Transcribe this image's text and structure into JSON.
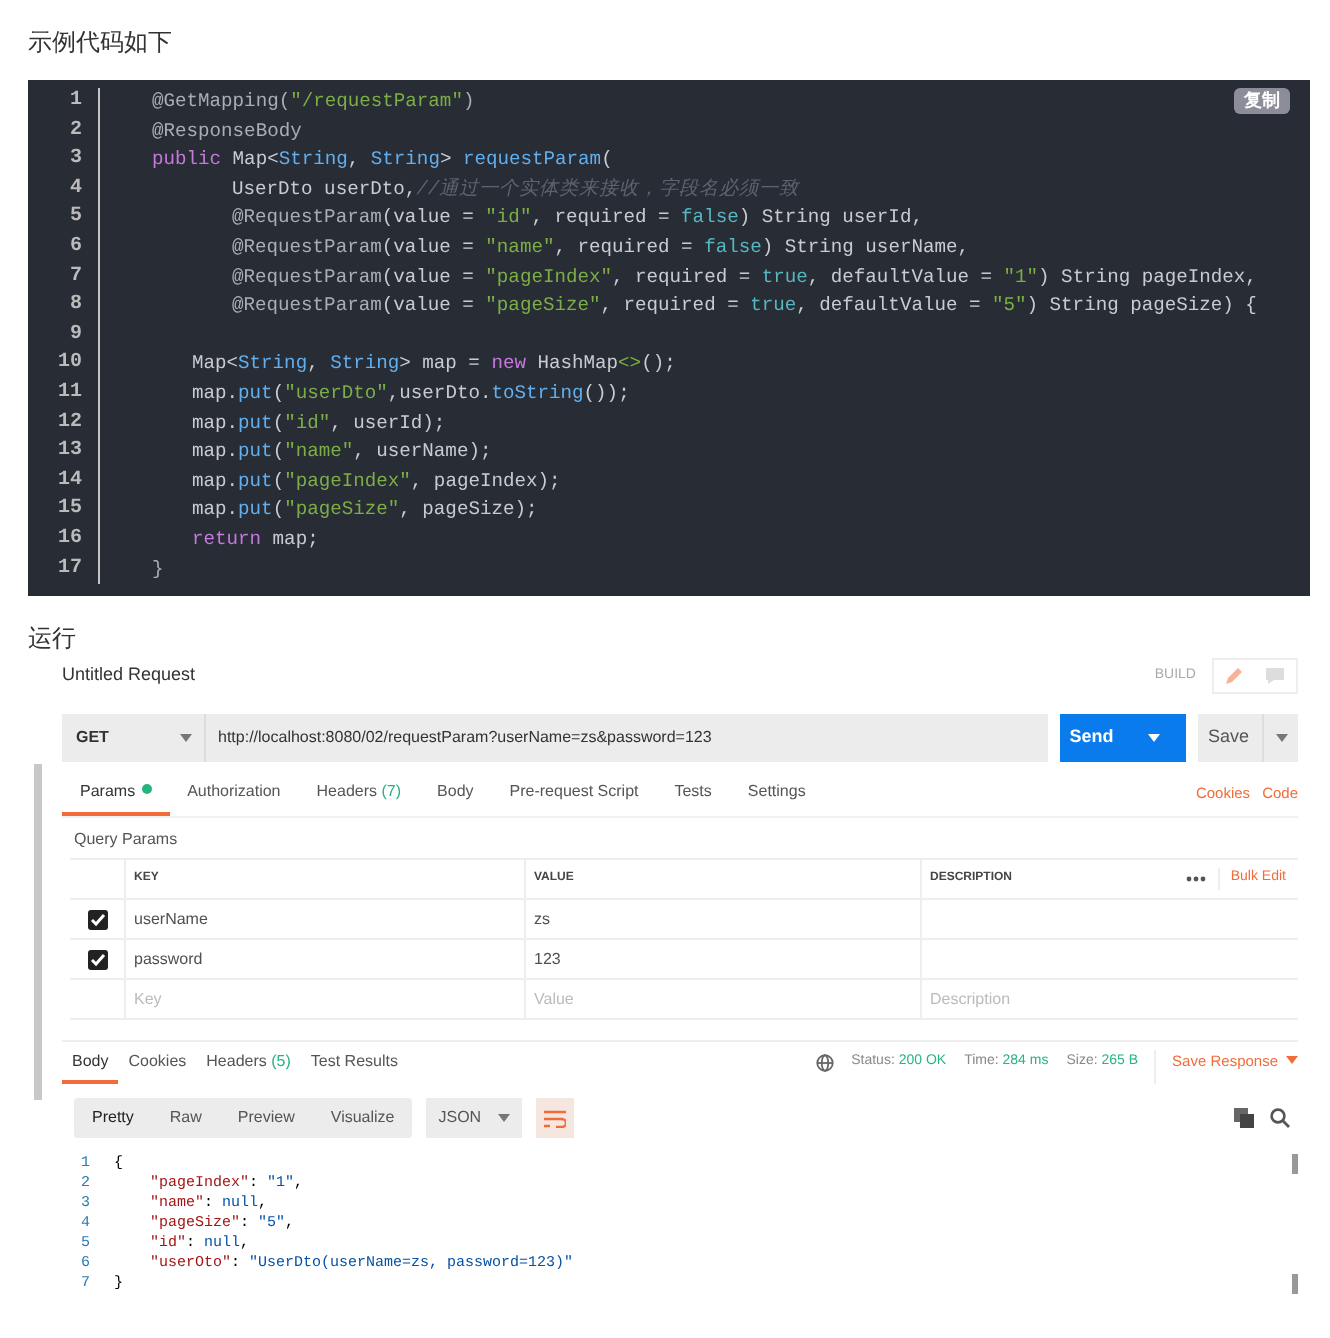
{
  "intro": "示例代码如下",
  "code_block": {
    "copy_label": "复制",
    "lines": [
      {
        "number": "1",
        "kind": "outer",
        "tokens": [
          {
            "kind": "ann",
            "text": "@GetMapping("
          },
          {
            "kind": "str",
            "text": "\"/requestParam\""
          },
          {
            "kind": "ann",
            "text": ")"
          }
        ]
      },
      {
        "number": "2",
        "kind": "outer",
        "tokens": [
          {
            "kind": "ann",
            "text": "@ResponseBody"
          }
        ]
      },
      {
        "number": "3",
        "kind": "outer",
        "tokens": [
          {
            "kind": "kw",
            "text": "public"
          },
          {
            "kind": "pl",
            "text": " Map<"
          },
          {
            "kind": "ty",
            "text": "String"
          },
          {
            "kind": "pl",
            "text": ", "
          },
          {
            "kind": "ty",
            "text": "String"
          },
          {
            "kind": "pl",
            "text": "> "
          },
          {
            "kind": "fn",
            "text": "requestParam"
          },
          {
            "kind": "pl",
            "text": "("
          }
        ]
      },
      {
        "number": "4",
        "kind": "param",
        "tokens": [
          {
            "kind": "pl",
            "text": "UserDto userDto,"
          },
          {
            "kind": "cm",
            "text": "//通过一个实体类来接收，字段名必须一致"
          }
        ]
      },
      {
        "number": "5",
        "kind": "param",
        "tokens": [
          {
            "kind": "ann",
            "text": "@RequestParam"
          },
          {
            "kind": "pl",
            "text": "(value = "
          },
          {
            "kind": "str",
            "text": "\"id\""
          },
          {
            "kind": "pl",
            "text": ", required = "
          },
          {
            "kind": "lit",
            "text": "false"
          },
          {
            "kind": "pl",
            "text": ") String userId,"
          }
        ]
      },
      {
        "number": "6",
        "kind": "param",
        "tokens": [
          {
            "kind": "ann",
            "text": "@RequestParam"
          },
          {
            "kind": "pl",
            "text": "(value = "
          },
          {
            "kind": "str",
            "text": "\"name\""
          },
          {
            "kind": "pl",
            "text": ", required = "
          },
          {
            "kind": "lit",
            "text": "false"
          },
          {
            "kind": "pl",
            "text": ") String userName,"
          }
        ]
      },
      {
        "number": "7",
        "kind": "param",
        "tokens": [
          {
            "kind": "ann",
            "text": "@RequestParam"
          },
          {
            "kind": "pl",
            "text": "(value = "
          },
          {
            "kind": "str",
            "text": "\"pageIndex\""
          },
          {
            "kind": "pl",
            "text": ", required = "
          },
          {
            "kind": "lit",
            "text": "true"
          },
          {
            "kind": "pl",
            "text": ", defaultValue = "
          },
          {
            "kind": "str",
            "text": "\"1\""
          },
          {
            "kind": "pl",
            "text": ") String pageIndex,"
          }
        ]
      },
      {
        "number": "8",
        "kind": "param",
        "tokens": [
          {
            "kind": "ann",
            "text": "@RequestParam"
          },
          {
            "kind": "pl",
            "text": "(value = "
          },
          {
            "kind": "str",
            "text": "\"pageSize\""
          },
          {
            "kind": "pl",
            "text": ", required = "
          },
          {
            "kind": "lit",
            "text": "true"
          },
          {
            "kind": "pl",
            "text": ", defaultValue = "
          },
          {
            "kind": "str",
            "text": "\"5\""
          },
          {
            "kind": "pl",
            "text": ") String pageSize) {"
          }
        ]
      },
      {
        "number": "9",
        "kind": "body"
      },
      {
        "number": "10",
        "kind": "body",
        "tokens": [
          {
            "kind": "pl",
            "text": "Map<"
          },
          {
            "kind": "ty",
            "text": "String"
          },
          {
            "kind": "pl",
            "text": ", "
          },
          {
            "kind": "ty",
            "text": "String"
          },
          {
            "kind": "pl",
            "text": "> map = "
          },
          {
            "kind": "kw",
            "text": "new"
          },
          {
            "kind": "pl",
            "text": " HashMap"
          },
          {
            "kind": "str",
            "text": "<>"
          },
          {
            "kind": "pl",
            "text": "();"
          }
        ]
      },
      {
        "number": "11",
        "kind": "body",
        "tokens": [
          {
            "kind": "pl",
            "text": "map."
          },
          {
            "kind": "fn",
            "text": "put"
          },
          {
            "kind": "pl",
            "text": "("
          },
          {
            "kind": "str",
            "text": "\"userDto\""
          },
          {
            "kind": "pl",
            "text": ",userDto."
          },
          {
            "kind": "fn",
            "text": "toString"
          },
          {
            "kind": "pl",
            "text": "());"
          }
        ]
      },
      {
        "number": "12",
        "kind": "body",
        "tokens": [
          {
            "kind": "pl",
            "text": "map."
          },
          {
            "kind": "fn",
            "text": "put"
          },
          {
            "kind": "pl",
            "text": "("
          },
          {
            "kind": "str",
            "text": "\"id\""
          },
          {
            "kind": "pl",
            "text": ", userId);"
          }
        ]
      },
      {
        "number": "13",
        "kind": "body",
        "tokens": [
          {
            "kind": "pl",
            "text": "map."
          },
          {
            "kind": "fn",
            "text": "put"
          },
          {
            "kind": "pl",
            "text": "("
          },
          {
            "kind": "str",
            "text": "\"name\""
          },
          {
            "kind": "pl",
            "text": ", userName);"
          }
        ]
      },
      {
        "number": "14",
        "kind": "body",
        "tokens": [
          {
            "kind": "pl",
            "text": "map."
          },
          {
            "kind": "fn",
            "text": "put"
          },
          {
            "kind": "pl",
            "text": "("
          },
          {
            "kind": "str",
            "text": "\"pageIndex\""
          },
          {
            "kind": "pl",
            "text": ", pageIndex);"
          }
        ]
      },
      {
        "number": "15",
        "kind": "body",
        "tokens": [
          {
            "kind": "pl",
            "text": "map."
          },
          {
            "kind": "fn",
            "text": "put"
          },
          {
            "kind": "pl",
            "text": "("
          },
          {
            "kind": "str",
            "text": "\"pageSize\""
          },
          {
            "kind": "pl",
            "text": ", pageSize);"
          }
        ]
      },
      {
        "number": "16",
        "kind": "body",
        "tokens": [
          {
            "kind": "kw",
            "text": "return"
          },
          {
            "kind": "pl",
            "text": " map;"
          }
        ]
      },
      {
        "number": "17",
        "kind": "outer",
        "tokens": [
          {
            "kind": "ann",
            "text": "}"
          }
        ]
      }
    ]
  },
  "run_label": "运行",
  "postman": {
    "title": "Untitled Request",
    "build_label": "BUILD",
    "method": "GET",
    "url": "http://localhost:8080/02/requestParam?userName=zs&password=123",
    "send_label": "Send",
    "save_label": "Save",
    "request_tabs": [
      {
        "label": "Params",
        "dot": true,
        "selected": true
      },
      {
        "label": "Authorization",
        "dot": false,
        "selected": false
      },
      {
        "label": "Headers",
        "count": "(7)",
        "dot": false,
        "selected": false
      },
      {
        "label": "Body",
        "dot": false,
        "selected": false
      },
      {
        "label": "Pre-request Script",
        "dot": false,
        "selected": false
      },
      {
        "label": "Tests",
        "dot": false,
        "selected": false
      },
      {
        "label": "Settings",
        "dot": false,
        "selected": false
      }
    ],
    "links": [
      "Cookies",
      "Code"
    ],
    "query_params_title": "Query Params",
    "params": {
      "columns": [
        "KEY",
        "VALUE",
        "DESCRIPTION"
      ],
      "bulk_edit": "Bulk Edit",
      "rows": [
        {
          "key": "userName",
          "value": "zs",
          "checked": true
        },
        {
          "key": "password",
          "value": "123",
          "checked": true
        }
      ],
      "placeholders": {
        "key": "Key",
        "value": "Value",
        "description": "Description"
      }
    },
    "response_tabs": [
      {
        "label": "Body",
        "selected": true
      },
      {
        "label": "Cookies",
        "selected": false
      },
      {
        "label": "Headers",
        "count": "(5)",
        "selected": false
      },
      {
        "label": "Test Results",
        "selected": false
      }
    ],
    "status": [
      {
        "label": "Status:",
        "value": "200 OK"
      },
      {
        "label": "Time:",
        "value": "284 ms"
      },
      {
        "label": "Size:",
        "value": "265 B"
      }
    ],
    "save_response": "Save Response",
    "view_modes": [
      {
        "label": "Pretty",
        "selected": true
      },
      {
        "label": "Raw",
        "selected": false
      },
      {
        "label": "Preview",
        "selected": false
      },
      {
        "label": "Visualize",
        "selected": false
      }
    ],
    "format": "JSON",
    "body_lines": [
      {
        "number": "1",
        "kind": "brace",
        "tokens": [
          {
            "kind": "p",
            "text": "{"
          }
        ]
      },
      {
        "number": "2",
        "kind": "field",
        "tokens": [
          {
            "kind": "key",
            "text": "\"pageIndex\""
          },
          {
            "kind": "p",
            "text": ": "
          },
          {
            "kind": "s",
            "text": "\"1\""
          },
          {
            "kind": "p",
            "text": ","
          }
        ]
      },
      {
        "number": "3",
        "kind": "field",
        "tokens": [
          {
            "kind": "key",
            "text": "\"name\""
          },
          {
            "kind": "p",
            "text": ": "
          },
          {
            "kind": "n",
            "text": "null"
          },
          {
            "kind": "p",
            "text": ","
          }
        ]
      },
      {
        "number": "4",
        "kind": "field",
        "tokens": [
          {
            "kind": "key",
            "text": "\"pageSize\""
          },
          {
            "kind": "p",
            "text": ": "
          },
          {
            "kind": "s",
            "text": "\"5\""
          },
          {
            "kind": "p",
            "text": ","
          }
        ]
      },
      {
        "number": "5",
        "kind": "field",
        "tokens": [
          {
            "kind": "key",
            "text": "\"id\""
          },
          {
            "kind": "p",
            "text": ": "
          },
          {
            "kind": "n",
            "text": "null"
          },
          {
            "kind": "p",
            "text": ","
          }
        ]
      },
      {
        "number": "6",
        "kind": "field",
        "tokens": [
          {
            "kind": "key",
            "text": "\"userOto\""
          },
          {
            "kind": "p",
            "text": ": "
          },
          {
            "kind": "s",
            "text": "\"UserDto(userName=zs, password=123)\""
          }
        ]
      },
      {
        "number": "7",
        "kind": "brace",
        "tokens": [
          {
            "kind": "p",
            "text": "}"
          }
        ]
      }
    ]
  }
}
